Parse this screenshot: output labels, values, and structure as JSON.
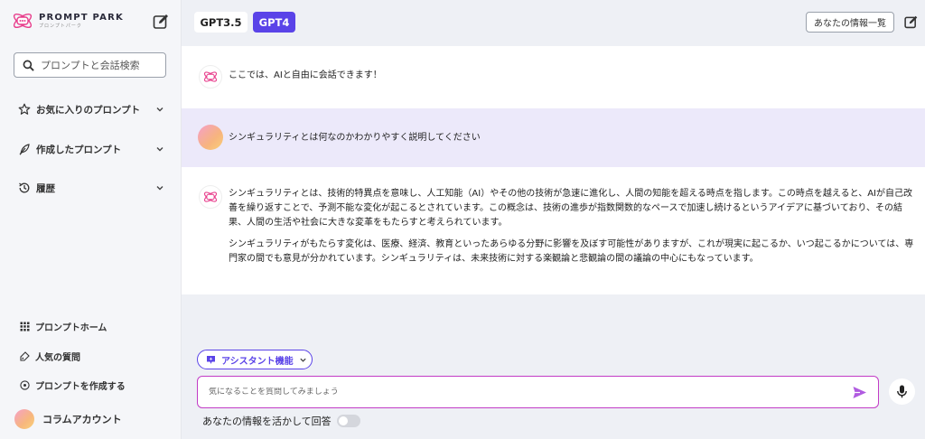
{
  "sidebar": {
    "logo": {
      "name": "PROMPT PARK",
      "sub": "プロンプトパーク"
    },
    "search_placeholder": "プロンプトと会話検索",
    "nav": [
      {
        "label": "お気に入りのプロンプト",
        "icon": "star-icon"
      },
      {
        "label": "作成したプロンプト",
        "icon": "feather-icon"
      },
      {
        "label": "履歴",
        "icon": "history-icon"
      }
    ],
    "links": [
      {
        "label": "プロンプトホーム",
        "icon": "grid-icon"
      },
      {
        "label": "人気の質問",
        "icon": "tag-icon"
      },
      {
        "label": "プロンプトを作成する",
        "icon": "plus-circle-icon"
      }
    ],
    "account_label": "コラムアカウント"
  },
  "header": {
    "tabs": [
      "GPT3.5",
      "GPT4"
    ],
    "active_tab": "GPT4",
    "info_button": "あなたの情報一覧"
  },
  "messages": [
    {
      "role": "assistant",
      "text": "ここでは、AIと自由に会話できます！"
    },
    {
      "role": "user",
      "text": "シンギュラリティとは何なのかわかりやすく説明してください"
    },
    {
      "role": "assistant",
      "paragraphs": [
        "シンギュラリティとは、技術的特異点を意味し、人工知能（AI）やその他の技術が急速に進化し、人間の知能を超える時点を指します。この時点を越えると、AIが自己改善を繰り返すことで、予測不能な変化が起こるとされています。この概念は、技術の進歩が指数関数的なペースで加速し続けるというアイデアに基づいており、その結果、人間の生活や社会に大きな変革をもたらすと考えられています。",
        "シンギュラリティがもたらす変化は、医療、経済、教育といったあらゆる分野に影響を及ぼす可能性がありますが、これが現実に起こるか、いつ起こるかについては、専門家の間でも意見が分かれています。シンギュラリティは、未来技術に対する楽観論と悲観論の間の議論の中心にもなっています。"
      ]
    }
  ],
  "composer": {
    "assistant_button": "アシスタント機能",
    "placeholder": "気になることを質問してみましょう",
    "toggle_label": "あなたの情報を活かして回答",
    "toggle_on": false
  },
  "colors": {
    "accent": "#5a43e8",
    "input_border": "#c23cc6",
    "user_row_bg": "#ece9fa"
  }
}
